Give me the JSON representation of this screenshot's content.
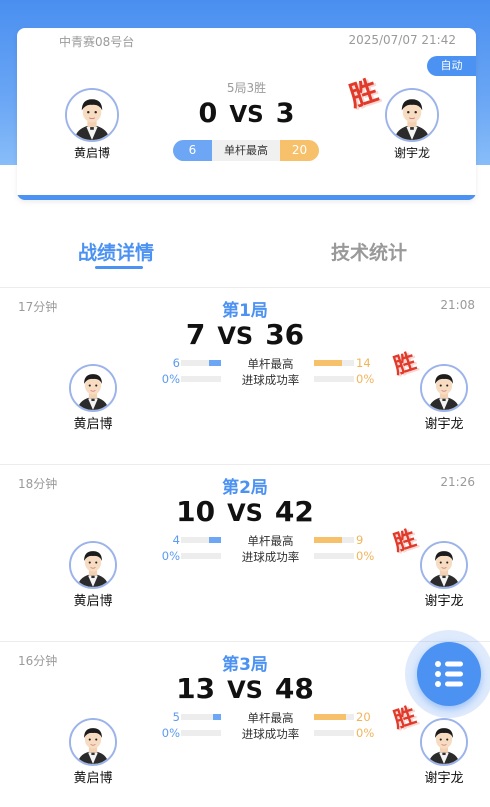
{
  "header": {
    "table_name": "中青赛08号台",
    "datetime": "2025/07/07 21:42",
    "mode_badge": "自动",
    "format": "5局3胜",
    "score_left": "0",
    "vs": "VS",
    "score_right": "3",
    "win_mark": "胜",
    "stat_label": "单杆最高",
    "stat_left": "6",
    "stat_right": "20",
    "player_left": "黄启博",
    "player_right": "谢宇龙"
  },
  "tabs": [
    {
      "label": "战绩详情",
      "active": true
    },
    {
      "label": "技术统计",
      "active": false
    }
  ],
  "rounds": [
    {
      "duration": "17分钟",
      "title": "第1局",
      "end_time": "21:08",
      "score_left": "7",
      "vs": "VS",
      "score_right": "36",
      "high_break_label": "单杆最高",
      "high_break_left": "6",
      "high_break_right": "14",
      "high_break_left_fill": 0.3,
      "high_break_right_fill": 0.7,
      "pot_rate_label": "进球成功率",
      "pot_rate_left": "0%",
      "pot_rate_right": "0%",
      "player_left": "黄启博",
      "player_right": "谢宇龙",
      "win_mark": "胜"
    },
    {
      "duration": "18分钟",
      "title": "第2局",
      "end_time": "21:26",
      "score_left": "10",
      "vs": "VS",
      "score_right": "42",
      "high_break_label": "单杆最高",
      "high_break_left": "4",
      "high_break_right": "9",
      "high_break_left_fill": 0.3,
      "high_break_right_fill": 0.7,
      "pot_rate_label": "进球成功率",
      "pot_rate_left": "0%",
      "pot_rate_right": "0%",
      "player_left": "黄启博",
      "player_right": "谢宇龙",
      "win_mark": "胜"
    },
    {
      "duration": "16分钟",
      "title": "第3局",
      "end_time": "",
      "score_left": "13",
      "vs": "VS",
      "score_right": "48",
      "high_break_label": "单杆最高",
      "high_break_left": "5",
      "high_break_right": "20",
      "high_break_left_fill": 0.2,
      "high_break_right_fill": 0.8,
      "pot_rate_label": "进球成功率",
      "pot_rate_left": "0%",
      "pot_rate_right": "0%",
      "player_left": "黄启博",
      "player_right": "谢宇龙",
      "win_mark": "胜"
    }
  ],
  "fab": {
    "icon": "list-icon"
  },
  "colors": {
    "accent": "#4b92f2",
    "win": "#e23a2a",
    "left_stat": "#6ca6f5",
    "right_stat": "#f7c06b"
  }
}
